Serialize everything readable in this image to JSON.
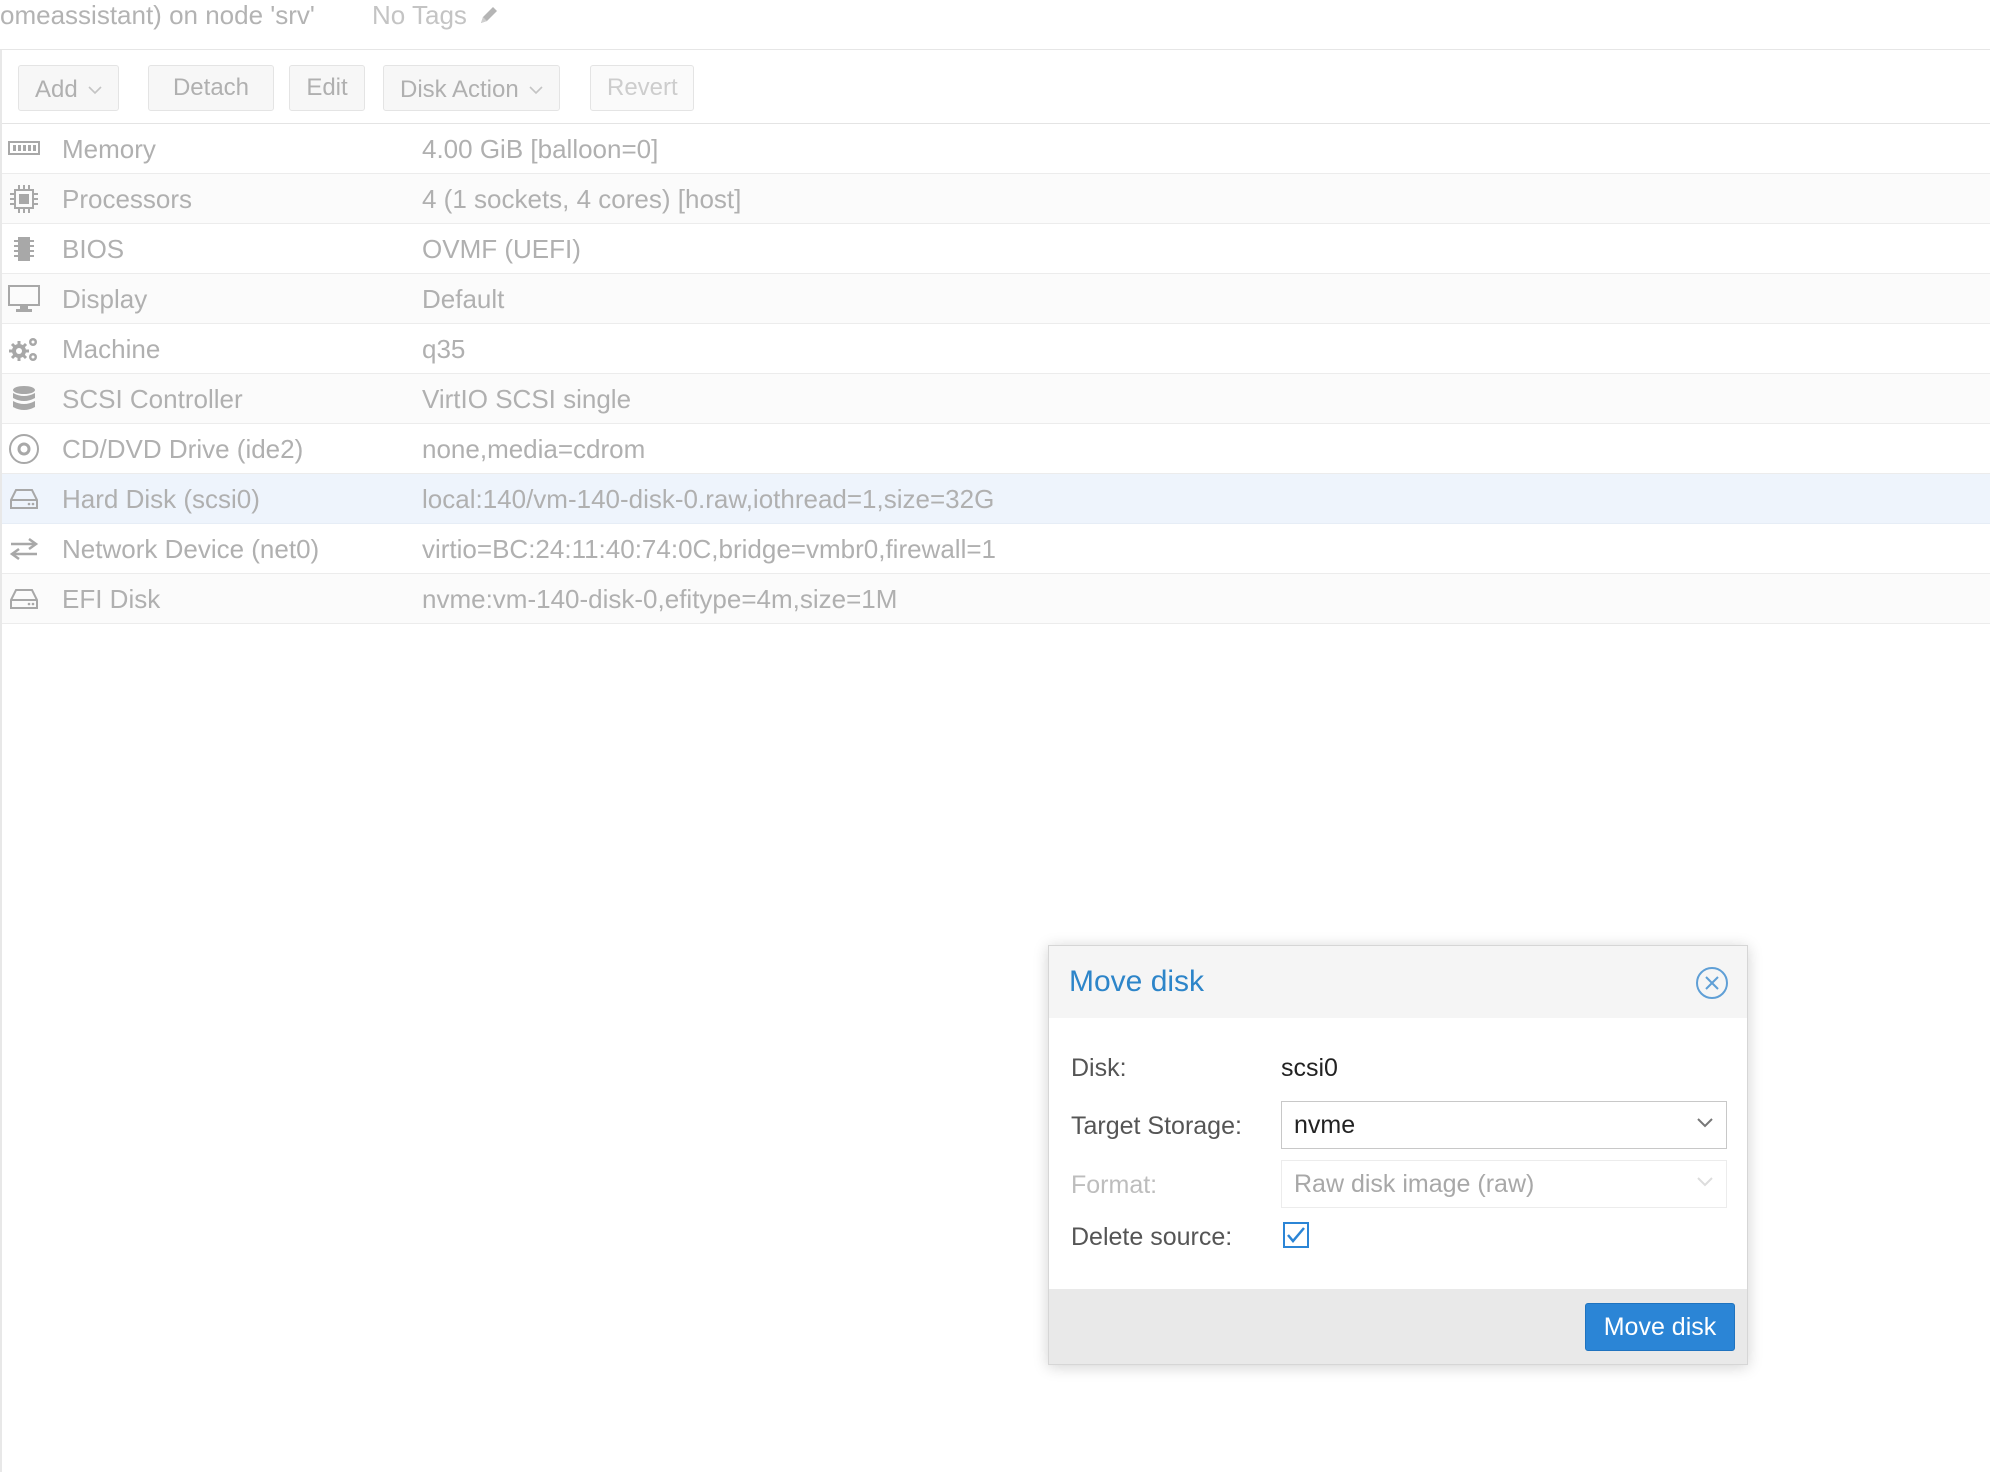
{
  "header": {
    "title": "omeassistant) on node 'srv'",
    "tags": "No Tags",
    "tags_icon": "pencil-icon"
  },
  "toolbar": {
    "add": "Add",
    "detach": "Detach",
    "edit": "Edit",
    "disk_action": "Disk Action",
    "revert": "Revert"
  },
  "rows": [
    {
      "name": "Memory",
      "value": "4.00 GiB [balloon=0]",
      "icon": "memory-icon"
    },
    {
      "name": "Processors",
      "value": "4 (1 sockets, 4 cores) [host]",
      "icon": "cpu-icon"
    },
    {
      "name": "BIOS",
      "value": "OVMF (UEFI)",
      "icon": "bios-chip-icon"
    },
    {
      "name": "Display",
      "value": "Default",
      "icon": "monitor-icon"
    },
    {
      "name": "Machine",
      "value": "q35",
      "icon": "gears-icon"
    },
    {
      "name": "SCSI Controller",
      "value": "VirtIO SCSI single",
      "icon": "database-icon"
    },
    {
      "name": "CD/DVD Drive (ide2)",
      "value": "none,media=cdrom",
      "icon": "cdrom-icon"
    },
    {
      "name": "Hard Disk (scsi0)",
      "value": "local:140/vm-140-disk-0.raw,iothread=1,size=32G",
      "icon": "hdd-icon"
    },
    {
      "name": "Network Device (net0)",
      "value": "virtio=BC:24:11:40:74:0C,bridge=vmbr0,firewall=1",
      "icon": "network-exchange-icon"
    },
    {
      "name": "EFI Disk",
      "value": "nvme:vm-140-disk-0,efitype=4m,size=1M",
      "icon": "hdd-icon"
    }
  ],
  "dialog": {
    "title": "Move disk",
    "disk_label": "Disk:",
    "disk_value": "scsi0",
    "target_label": "Target Storage:",
    "target_value": "nvme",
    "format_label": "Format:",
    "format_value": "Raw disk image (raw)",
    "delete_label": "Delete source:",
    "delete_checked": true,
    "submit": "Move disk"
  },
  "colors": {
    "accent": "#2b85d6",
    "title": "#2d85c9",
    "selected_row": "#eef4fc"
  }
}
